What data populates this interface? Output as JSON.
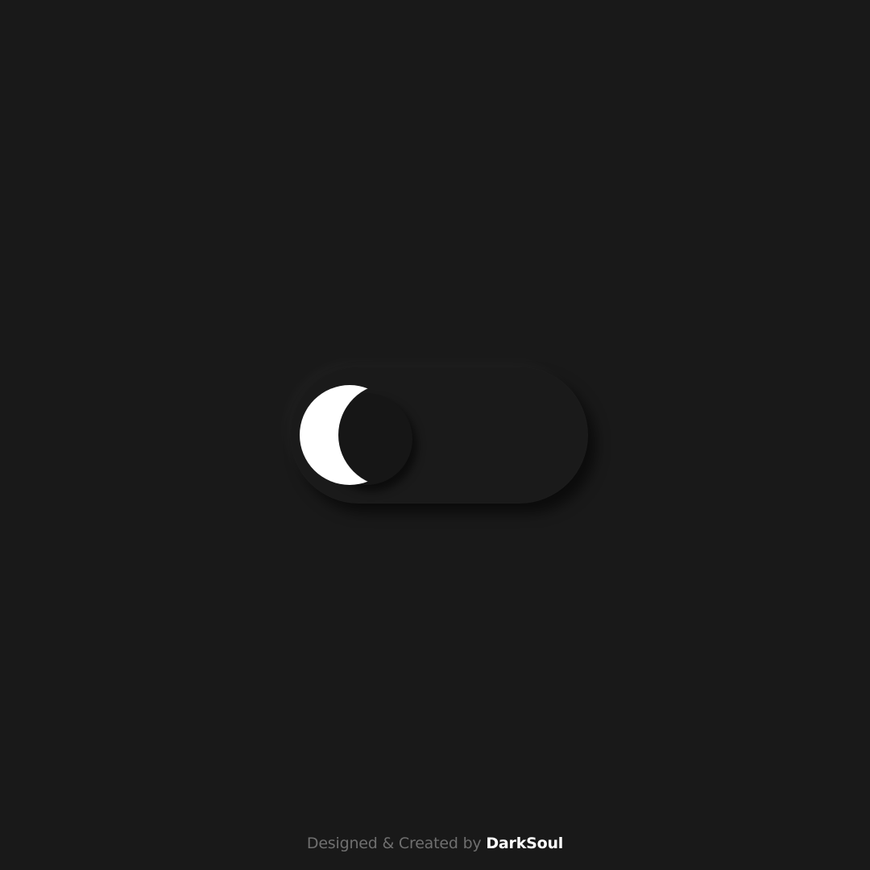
{
  "toggle": {
    "state": "off",
    "icon": "moon-icon",
    "background_color": "#191919",
    "knob_color": "#ffffff"
  },
  "footer": {
    "prefix": "Designed & Created by",
    "author": "DarkSoul"
  }
}
